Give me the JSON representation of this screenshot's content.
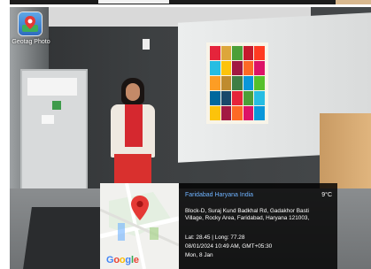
{
  "app": {
    "icon_name": "geotag-photo-app-icon",
    "label": "Geotag Photo"
  },
  "geotag": {
    "place": "Faridabad Haryana India",
    "temperature": "9°C",
    "address_line1": "Block-D, Suraj Kund Badkhal Rd, Gadakhor Basti",
    "address_line2": "Village, Rocky Area, Faridabad, Haryana 121003,",
    "coordinates": "Lat: 28.45 | Long: 77.28",
    "datetime": "08/01/2024 10:49 AM, GMT+05:30",
    "weekday": "Mon, 8 Jan"
  },
  "map": {
    "logo_letters": [
      "G",
      "o",
      "o",
      "g",
      "l",
      "e"
    ],
    "logo_colors": [
      "#4285F4",
      "#EA4335",
      "#FBBC05",
      "#4285F4",
      "#34A853",
      "#EA4335"
    ],
    "pin_color": "#E53935"
  }
}
